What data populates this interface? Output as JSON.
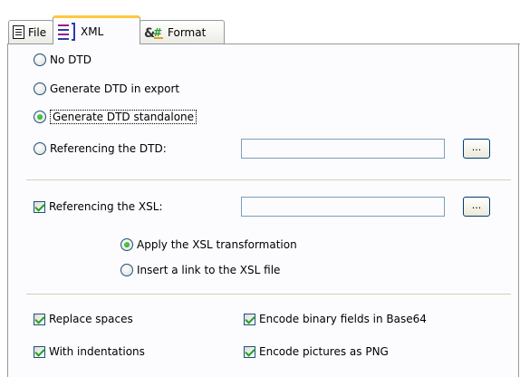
{
  "tabs": [
    {
      "label": "File",
      "icon": "file-icon",
      "active": false
    },
    {
      "label": "XML",
      "icon": "xml-icon",
      "active": true
    },
    {
      "label": "Format",
      "icon": "format-icon",
      "active": false
    }
  ],
  "dtd": {
    "options": [
      {
        "label": "No DTD",
        "checked": false
      },
      {
        "label": "Generate DTD in export",
        "checked": false
      },
      {
        "label": "Generate DTD standalone",
        "checked": true
      },
      {
        "label": "Referencing the DTD:",
        "checked": false
      }
    ],
    "path_value": "",
    "browse_label": "..."
  },
  "xsl": {
    "reference_label": "Referencing the XSL:",
    "reference_checked": true,
    "path_value": "",
    "browse_label": "...",
    "options": [
      {
        "label": "Apply the XSL transformation",
        "checked": true
      },
      {
        "label": "Insert a link to the XSL file",
        "checked": false
      }
    ]
  },
  "options": {
    "replace_spaces": {
      "label": "Replace spaces",
      "checked": true
    },
    "with_indentations": {
      "label": "With indentations",
      "checked": true
    },
    "encode_binary": {
      "label": "Encode binary fields in Base64",
      "checked": true
    },
    "encode_pictures": {
      "label": "Encode pictures as PNG",
      "checked": true
    }
  },
  "colors": {
    "active_tab_accent": "#ffc83c",
    "check_green": "#21a121",
    "control_border": "#1c5180"
  }
}
